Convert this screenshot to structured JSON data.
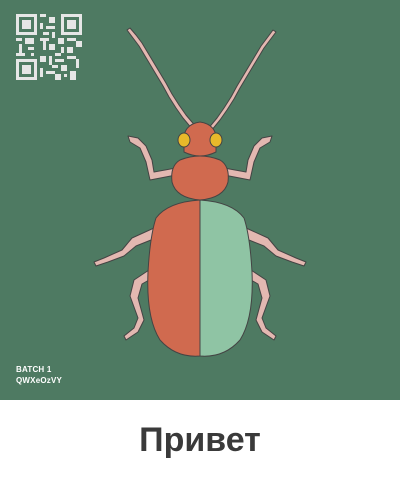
{
  "art": {
    "background_color": "#4e7a62",
    "batch_label": "BATCH 1",
    "batch_code": "QWXeOzVY",
    "qr_code_icon": "qr-code-icon"
  },
  "beetle": {
    "icon": "beetle-illustration",
    "colors": {
      "head": "#d06a4f",
      "eyes": "#e8b92a",
      "left_elytron": "#d06a4f",
      "right_elytron": "#8fc4a4",
      "legs": "#e3b8b1",
      "outline": "#333333"
    }
  },
  "caption": {
    "text": "Привет"
  }
}
